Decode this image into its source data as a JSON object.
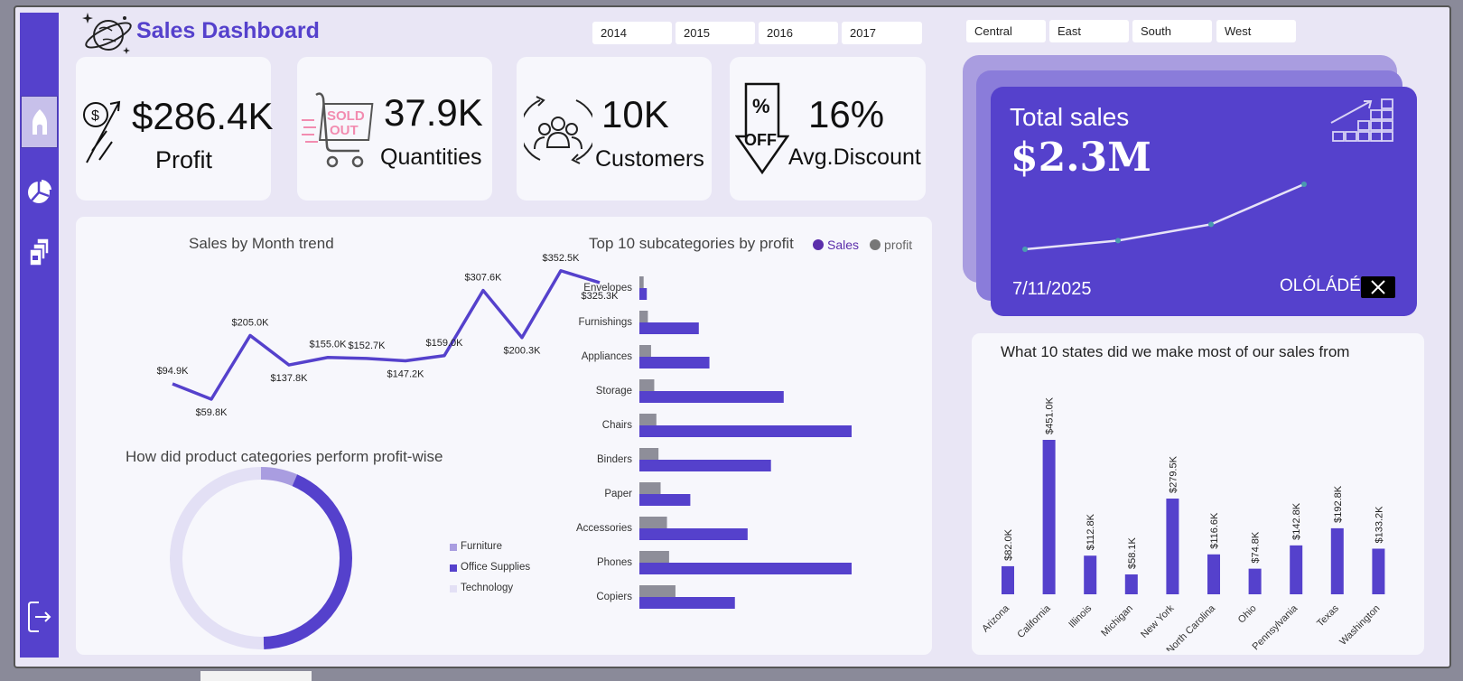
{
  "header": {
    "title": "Sales Dashboard"
  },
  "years": [
    "2014",
    "2015",
    "2016",
    "2017"
  ],
  "regions": [
    "Central",
    "East",
    "South",
    "West"
  ],
  "kpis": {
    "profit": {
      "value": "$286.4K",
      "label": "Profit"
    },
    "quantities": {
      "value": "37.9K",
      "label": "Quantities"
    },
    "customers": {
      "value": "10K",
      "label": "Customers"
    },
    "discount": {
      "value": "16%",
      "label": "Avg.Discount"
    }
  },
  "total_sales": {
    "label": "Total sales",
    "value": "$2.3M",
    "date": "7/11/2025",
    "author": "OLÓLÁDÉ"
  },
  "colors": {
    "accent": "#5541cc",
    "profit_bar": "#8e8e99",
    "furniture": "#a99de0",
    "technology": "#e3e0f5"
  },
  "sidebar": {
    "icons": [
      "home-icon",
      "pie-chart-icon",
      "documents-icon",
      "logout-icon"
    ]
  },
  "chart_data": [
    {
      "type": "line",
      "title": "Sales by Month trend",
      "values": [
        94.9,
        59.8,
        205.0,
        137.8,
        155.0,
        152.7,
        147.2,
        159.0,
        307.6,
        200.3,
        352.5,
        325.3
      ],
      "labels": [
        "$94.9K",
        "$59.8K",
        "$205.0K",
        "$137.8K",
        "$155.0K",
        "$152.7K",
        "$147.2K",
        "$159.0K",
        "$307.6K",
        "$200.3K",
        "$352.5K",
        "$325.3K"
      ]
    },
    {
      "type": "bar",
      "title": "Top 10 subcategories by profit",
      "categories": [
        "Envelopes",
        "Furnishings",
        "Appliances",
        "Storage",
        "Chairs",
        "Binders",
        "Paper",
        "Accessories",
        "Phones",
        "Copiers"
      ],
      "series": [
        {
          "name": "Sales",
          "values": [
            3.5,
            28,
            33,
            68,
            100,
            62,
            24,
            51,
            100,
            45
          ]
        },
        {
          "name": "profit",
          "values": [
            2,
            4,
            5.5,
            7,
            8,
            9,
            10,
            13,
            14,
            17
          ]
        }
      ],
      "legend": "top-right"
    },
    {
      "type": "pie",
      "title": "How did product categories perform profit-wise",
      "categories": [
        "Furniture",
        "Office Supplies",
        "Technology"
      ],
      "values": [
        6.5,
        43,
        50.5
      ]
    },
    {
      "type": "bar",
      "title": "What 10 states did we make most of our sales from",
      "categories": [
        "Arizona",
        "California",
        "Illinois",
        "Michigan",
        "New York",
        "North Carolina",
        "Ohio",
        "Pennsylvania",
        "Texas",
        "Washington"
      ],
      "values": [
        82.0,
        451.0,
        112.8,
        58.1,
        279.5,
        116.6,
        74.8,
        142.8,
        192.8,
        133.2
      ],
      "labels": [
        "$82.0K",
        "$451.0K",
        "$112.8K",
        "$58.1K",
        "$279.5K",
        "$116.6K",
        "$74.8K",
        "$142.8K",
        "$192.8K",
        "$133.2K"
      ]
    },
    {
      "type": "line",
      "values": [
        1,
        1.8,
        3.3,
        7
      ]
    }
  ]
}
